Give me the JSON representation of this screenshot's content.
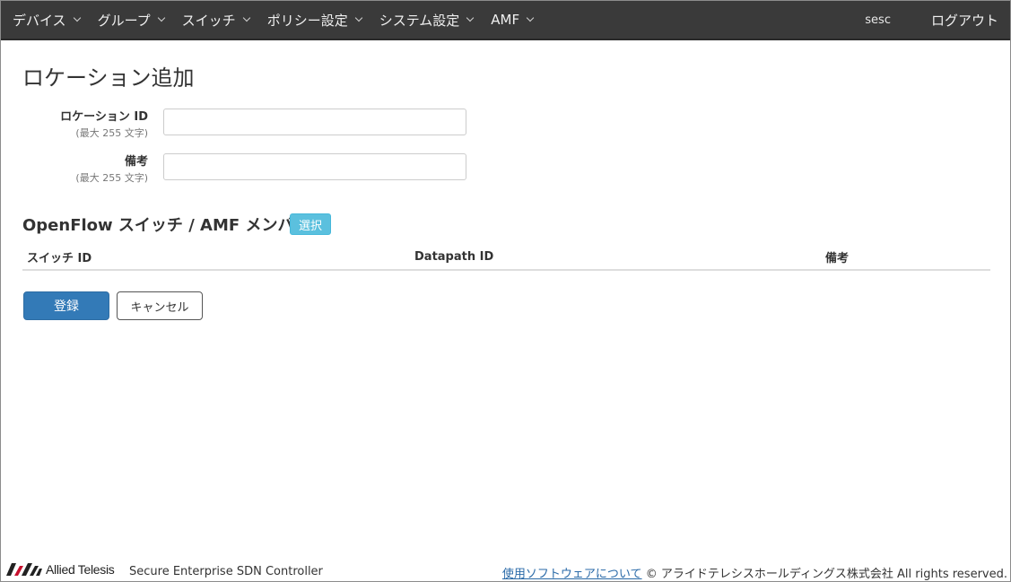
{
  "nav": {
    "menu": [
      {
        "label": "デバイス"
      },
      {
        "label": "グループ"
      },
      {
        "label": "スイッチ"
      },
      {
        "label": "ポリシー設定"
      },
      {
        "label": "システム設定"
      },
      {
        "label": "AMF"
      }
    ],
    "user": "sesc",
    "logout": "ログアウト"
  },
  "page": {
    "title": "ロケーション追加"
  },
  "form": {
    "location_id": {
      "label": "ロケーション ID",
      "hint": "(最大 255 文字)",
      "value": ""
    },
    "note": {
      "label": "備考",
      "hint": "(最大 255 文字)",
      "value": ""
    }
  },
  "members": {
    "title": "OpenFlow スイッチ / AMF メンバー",
    "select_label": "選択",
    "columns": [
      "スイッチ ID",
      "Datapath ID",
      "備考"
    ],
    "rows": []
  },
  "actions": {
    "submit": "登録",
    "cancel": "キャンセル"
  },
  "footer": {
    "brand": "Allied Telesis",
    "product": "Secure Enterprise SDN Controller",
    "link": "使用ソフトウェアについて",
    "copyright": "© アライドテレシスホールディングス株式会社 All rights reserved."
  }
}
